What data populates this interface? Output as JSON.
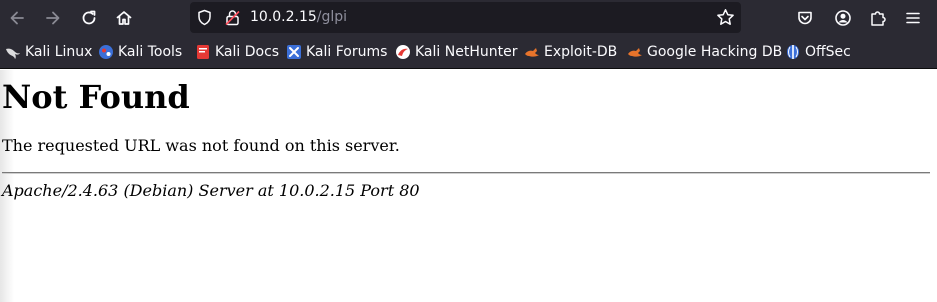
{
  "browser": {
    "url_host": "10.0.2.15",
    "url_path": "/glpi"
  },
  "bookmarks": [
    {
      "label": "Kali Linux",
      "icon": "kali-dragon-icon"
    },
    {
      "label": "Kali Tools",
      "icon": "kali-tools-icon"
    },
    {
      "label": "Kali Docs",
      "icon": "kali-docs-icon"
    },
    {
      "label": "Kali Forums",
      "icon": "kali-forums-icon"
    },
    {
      "label": "Kali NetHunter",
      "icon": "kali-nethunter-icon"
    },
    {
      "label": "Exploit-DB",
      "icon": "exploit-db-icon"
    },
    {
      "label": "Google Hacking DB",
      "icon": "ghdb-icon"
    },
    {
      "label": "OffSec",
      "icon": "offsec-icon"
    }
  ],
  "page": {
    "title": "Not Found",
    "message": "The requested URL was not found on this server.",
    "signature": "Apache/2.4.63 (Debian) Server at 10.0.2.15 Port 80"
  },
  "colors": {
    "toolbar_bg": "#2b2a33",
    "urlbar_bg": "#1c1b22",
    "kali_red": "#e53935",
    "exploit_orange": "#e8742b",
    "offsec_blue": "#3b6fd8"
  }
}
